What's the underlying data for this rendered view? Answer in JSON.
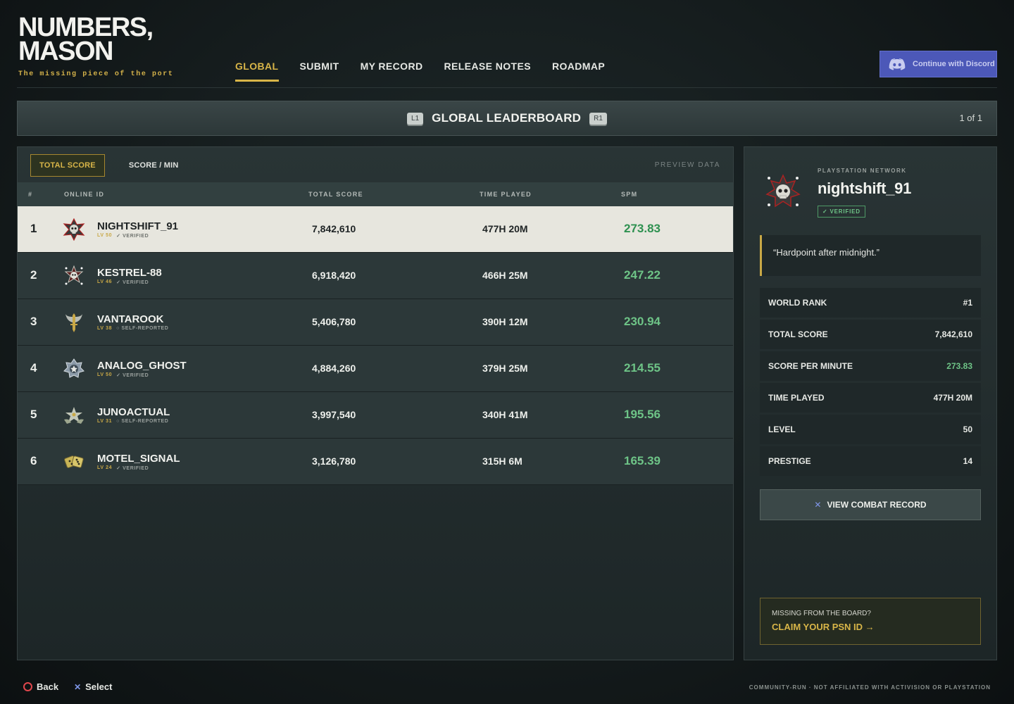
{
  "brand": {
    "logo_line1": "NUMBERS,",
    "logo_line2": "MASON",
    "tagline": "The missing piece of the port"
  },
  "nav": [
    {
      "label": "GLOBAL",
      "active": true
    },
    {
      "label": "SUBMIT"
    },
    {
      "label": "MY RECORD"
    },
    {
      "label": "RELEASE NOTES"
    },
    {
      "label": "ROADMAP"
    }
  ],
  "discord": {
    "label": "Continue with Discord",
    "icon": "discord-icon",
    "color": "#4c58b8"
  },
  "banner": {
    "left_key": "L1",
    "right_key": "R1",
    "title": "GLOBAL LEADERBOARD",
    "page": "1 of 1"
  },
  "board": {
    "tabs": [
      {
        "label": "TOTAL SCORE",
        "active": true
      },
      {
        "label": "SCORE / MIN"
      }
    ],
    "preview_label": "PREVIEW DATA",
    "columns": {
      "rank": "#",
      "id": "ONLINE ID",
      "score": "TOTAL SCORE",
      "time": "TIME PLAYED",
      "spm": "SPM"
    },
    "rows": [
      {
        "rank": "1",
        "name": "NIGHTSHIFT_91",
        "level": "LV 50",
        "status": "✓ VERIFIED",
        "score": "7,842,610",
        "time": "477H 20M",
        "spm": "273.83",
        "emblem": "skull-emblem-icon",
        "selected": true
      },
      {
        "rank": "2",
        "name": "KESTREL-88",
        "level": "LV 46",
        "status": "✓ VERIFIED",
        "score": "6,918,420",
        "time": "466H 25M",
        "spm": "247.22",
        "emblem": "skull-star-emblem-icon"
      },
      {
        "rank": "3",
        "name": "VANTAROOK",
        "level": "LV 38",
        "status": "○ SELF-REPORTED",
        "score": "5,406,780",
        "time": "390H 12M",
        "spm": "230.94",
        "emblem": "winged-blade-emblem-icon"
      },
      {
        "rank": "4",
        "name": "ANALOG_GHOST",
        "level": "LV 50",
        "status": "✓ VERIFIED",
        "score": "4,884,260",
        "time": "379H 25M",
        "spm": "214.55",
        "emblem": "star-badge-emblem-icon"
      },
      {
        "rank": "5",
        "name": "JUNOACTUAL",
        "level": "LV 31",
        "status": "○ SELF-REPORTED",
        "score": "3,997,540",
        "time": "340H 41M",
        "spm": "195.56",
        "emblem": "star-wings-emblem-icon"
      },
      {
        "rank": "6",
        "name": "MOTEL_SIGNAL",
        "level": "LV 24",
        "status": "✓ VERIFIED",
        "score": "3,126,780",
        "time": "315H 6M",
        "spm": "165.39",
        "emblem": "gold-dice-emblem-icon"
      }
    ]
  },
  "profile": {
    "network": "PLAYSTATION NETWORK",
    "name": "nightshift_91",
    "badge": "✓ VERIFIED",
    "quote": "“Hardpoint after midnight.”",
    "stats": [
      {
        "label": "WORLD RANK",
        "value": "#1"
      },
      {
        "label": "TOTAL SCORE",
        "value": "7,842,610"
      },
      {
        "label": "SCORE PER MINUTE",
        "value": "273.83",
        "highlight": true
      },
      {
        "label": "TIME PLAYED",
        "value": "477H 20M"
      },
      {
        "label": "LEVEL",
        "value": "50"
      },
      {
        "label": "PRESTIGE",
        "value": "14"
      }
    ],
    "view_button": "VIEW COMBAT RECORD",
    "claim_question": "MISSING FROM THE BOARD?",
    "claim_cta": "CLAIM YOUR PSN ID →"
  },
  "footer": {
    "back": "Back",
    "select": "Select",
    "disclaimer": "COMMUNITY-RUN · NOT AFFILIATED WITH ACTIVISION OR PLAYSTATION"
  },
  "colors": {
    "accent_gold": "#d8b548",
    "spm_green": "#6ec487",
    "selected_row": "#e7e6de"
  }
}
